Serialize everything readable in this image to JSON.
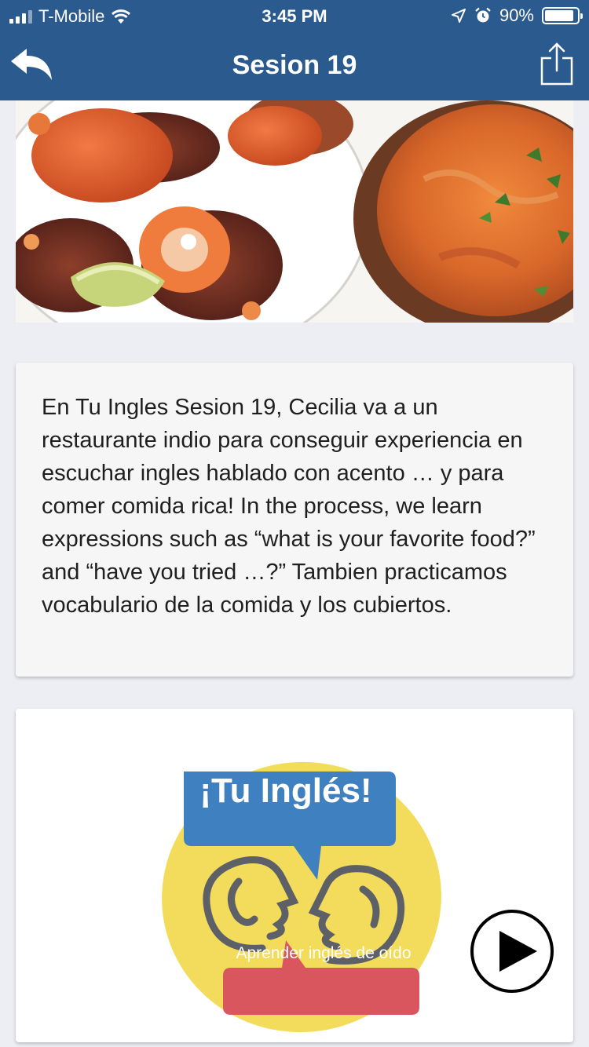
{
  "status_bar": {
    "carrier": "T-Mobile",
    "time": "3:45 PM",
    "battery": "90%",
    "battery_level": 0.9,
    "icons": [
      "signal-icon",
      "wifi-icon",
      "location-icon",
      "alarm-icon",
      "battery-icon"
    ]
  },
  "nav": {
    "title": "Sesion 19",
    "back_icon": "back-arrow-icon",
    "share_icon": "share-icon"
  },
  "description": "En Tu Ingles Sesion 19, Cecilia va a un restaurante indio para conseguir experiencia en escuchar ingles hablado con acento … y para comer comida rica! In the process, we learn expressions such as “what is your favorite food?” and “have you tried …?” Tambien practicamos vocabulario de la comida y los cubiertos.",
  "logo": {
    "headline": "¡Tu Inglés!",
    "tagline": "Aprender inglés de oído"
  },
  "player": {
    "icon": "play-icon"
  },
  "colors": {
    "nav_bar": "#2b5a8e",
    "logo_yellow": "#f3dc5c",
    "bubble_blue": "#3f80c0",
    "bubble_red": "#d9565f"
  }
}
